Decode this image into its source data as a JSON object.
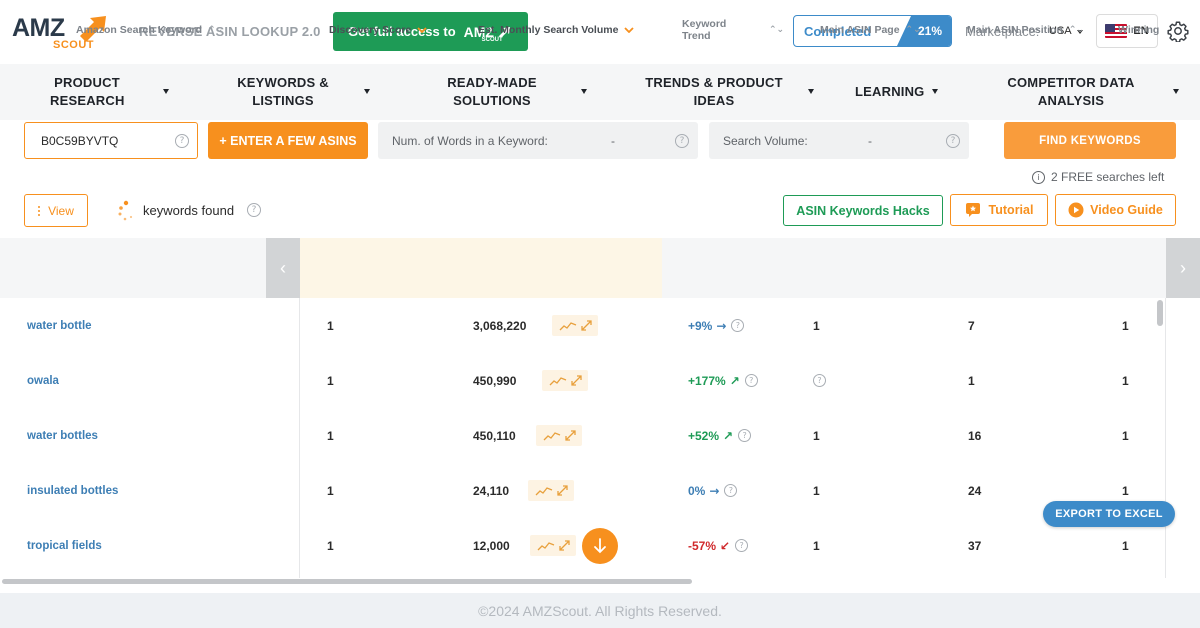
{
  "brand": {
    "logo_main": "AMZ",
    "logo_sub": "SCOUT",
    "tool_name": "REVERSE ASIN LOOKUP 2.0",
    "colors": {
      "orange": "#f7901e",
      "green": "#1e9b56",
      "blue": "#3d8bc9",
      "navy": "#2b3a4a"
    }
  },
  "header": {
    "access_button": "Get full access to",
    "access_logo": "AMZ",
    "access_logo_sub": "SCOUT",
    "progress_label": "Completed",
    "progress_value": "21%",
    "progress_fraction": 0.21,
    "marketplace_label": "Marketplace:",
    "marketplace_value": "USA",
    "language": "EN",
    "settings_icon": "gear-icon"
  },
  "nav": {
    "items": [
      {
        "label": "PRODUCT RESEARCH"
      },
      {
        "label": "KEYWORDS & LISTINGS"
      },
      {
        "label": "READY-MADE SOLUTIONS"
      },
      {
        "label": "TRENDS & PRODUCT IDEAS"
      },
      {
        "label": "LEARNING"
      },
      {
        "label": "COMPETITOR DATA ANALYSIS"
      }
    ]
  },
  "search": {
    "asin_value": "B0C59BYVTQ",
    "enter_asins_button": "+ ENTER A FEW ASINS",
    "words_filter_label": "Num. of Words in a Keyword:",
    "words_filter_value": "-",
    "volume_filter_label": "Search Volume:",
    "volume_filter_value": "-",
    "find_button": "FIND KEYWORDS",
    "free_searches": "2 FREE searches left"
  },
  "toolbar": {
    "view_button": "View",
    "found_label": "keywords found",
    "hacks_button": "ASIN Keywords Hacks",
    "tutorial_button": "Tutorial",
    "video_button": "Video Guide"
  },
  "table": {
    "columns": [
      "Amazon Search Keyword",
      "Discovery Score",
      "Est. Monthly Search Volume",
      "Keyword Trend",
      "Main ASIN Page",
      "Main ASIN Position",
      "Winning"
    ],
    "rows": [
      {
        "keyword": "water bottle",
        "score": "1",
        "volume": "3,068,220",
        "trend": "+9%",
        "trend_dir": "flat",
        "page": "1",
        "position": "7",
        "winning": "1"
      },
      {
        "keyword": "owala",
        "score": "1",
        "volume": "450,990",
        "trend": "+177%",
        "trend_dir": "up",
        "page": "?",
        "position": "1",
        "winning": "1"
      },
      {
        "keyword": "water bottles",
        "score": "1",
        "volume": "450,110",
        "trend": "+52%",
        "trend_dir": "up",
        "page": "1",
        "position": "16",
        "winning": "1"
      },
      {
        "keyword": "insulated bottles",
        "score": "1",
        "volume": "24,110",
        "trend": "0%",
        "trend_dir": "flat",
        "page": "1",
        "position": "24",
        "winning": "1"
      },
      {
        "keyword": "tropical fields",
        "score": "1",
        "volume": "12,000",
        "trend": "-57%",
        "trend_dir": "down",
        "page": "1",
        "position": "37",
        "winning": "1"
      }
    ]
  },
  "export_button": "EXPORT TO EXCEL",
  "footer": "©2024 AMZScout. All Rights Reserved."
}
